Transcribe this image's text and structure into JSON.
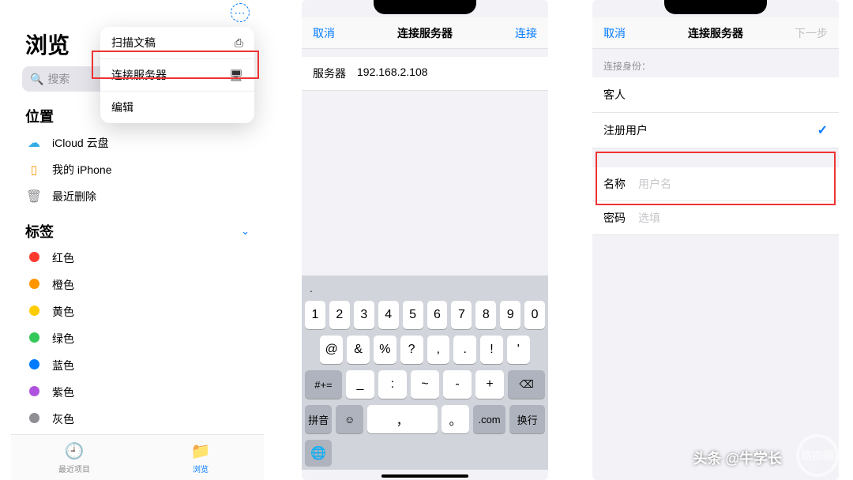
{
  "watermark": {
    "text": "头条 @牛学长",
    "badge": "路由器"
  },
  "screen1": {
    "title": "浏览",
    "search_placeholder": "搜索",
    "more_icon": "⋯",
    "popover": {
      "scan": {
        "label": "扫描文稿",
        "icon": "⎙"
      },
      "connect": {
        "label": "连接服务器",
        "icon": "🖥"
      },
      "edit": {
        "label": "编辑"
      }
    },
    "locations": {
      "header": "位置",
      "chevron": "⌄",
      "icloud": "iCloud 云盘",
      "myiphone": "我的 iPhone",
      "trash": "最近删除"
    },
    "tags": {
      "header": "标签",
      "chevron": "⌄",
      "items": [
        {
          "label": "红色",
          "color": "#ff3b30"
        },
        {
          "label": "橙色",
          "color": "#ff9500"
        },
        {
          "label": "黄色",
          "color": "#ffcc00"
        },
        {
          "label": "绿色",
          "color": "#34c759"
        },
        {
          "label": "蓝色",
          "color": "#007aff"
        },
        {
          "label": "紫色",
          "color": "#af52de"
        },
        {
          "label": "灰色",
          "color": "#8e8e93"
        }
      ]
    },
    "tabbar": {
      "recents": "最近项目",
      "browse": "浏览"
    }
  },
  "screen2": {
    "nav": {
      "cancel": "取消",
      "title": "连接服务器",
      "connect": "连接"
    },
    "server_label": "服务器",
    "server_value": "192.168.2.108",
    "keyboard": {
      "prediction": ".",
      "row1": [
        "1",
        "2",
        "3",
        "4",
        "5",
        "6",
        "7",
        "8",
        "9",
        "0"
      ],
      "row2": [
        "@",
        "&",
        "%",
        "?",
        ",",
        ".",
        "!",
        "'"
      ],
      "shift": "#+=",
      "row3": [
        "_",
        ":",
        "~",
        "-",
        "+"
      ],
      "backspace": "⌫",
      "bottom": {
        "pinyin": "拼音",
        "emoji": "☺",
        "space": "，",
        "dot": "。",
        "dotcom": ".com",
        "return": "换行"
      },
      "globe": "🌐"
    }
  },
  "screen3": {
    "nav": {
      "cancel": "取消",
      "title": "连接服务器",
      "next": "下一步"
    },
    "identity_note": "连接身份：",
    "guest": "客人",
    "registered": "注册用户",
    "fields": {
      "name_label": "名称",
      "name_ph": "用户名",
      "pw_label": "密码",
      "pw_ph": "选填"
    }
  }
}
